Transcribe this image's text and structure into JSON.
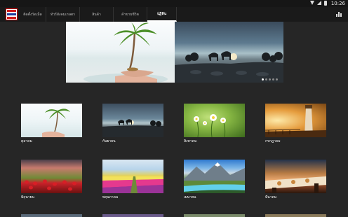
{
  "status_bar": {
    "time": "10:26"
  },
  "tabs": [
    {
      "label": "ติดตั้งวัดเม็ด",
      "active": false
    },
    {
      "label": "ทัวร์สังคมเกษตร",
      "active": false
    },
    {
      "label": "สินค้า",
      "active": false
    },
    {
      "label": "ค้าขายชีวิต",
      "active": false
    },
    {
      "label": "ปฏิทิน",
      "active": true
    }
  ],
  "hero": {
    "slides": 5,
    "current": 1
  },
  "months": [
    {
      "label": "ตุลาคม",
      "art": "palm"
    },
    {
      "label": "กันยายน",
      "art": "dogs"
    },
    {
      "label": "สิงหาคม",
      "art": "flowers"
    },
    {
      "label": "กรกฎาคม",
      "art": "lighthouse"
    },
    {
      "label": "มิถุนายน",
      "art": "tulips"
    },
    {
      "label": "พฤษภาคม",
      "art": "field"
    },
    {
      "label": "เมษายน",
      "art": "mountain"
    },
    {
      "label": "มีนาคม",
      "art": "dinner"
    }
  ],
  "colors": {
    "background": "#262626",
    "appbar": "#1a1a1a",
    "accent": "#ffffff"
  }
}
